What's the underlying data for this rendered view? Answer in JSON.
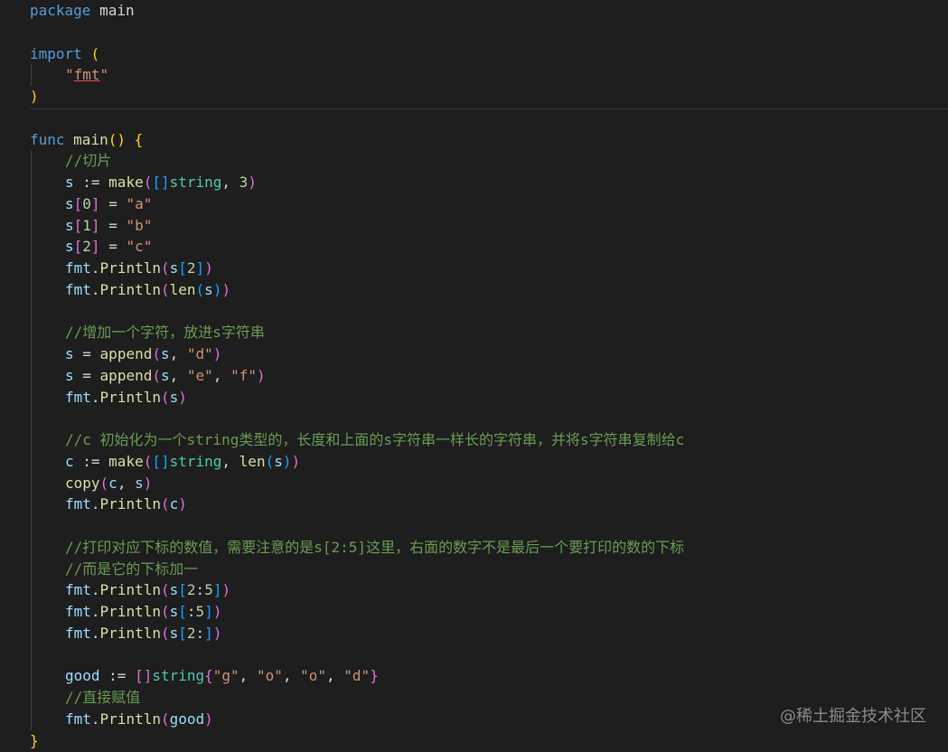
{
  "editor": {
    "lines": [
      {
        "indent": 0,
        "tokens": [
          [
            "package",
            "k"
          ],
          [
            " main",
            "d"
          ]
        ]
      },
      {
        "indent": 0,
        "tokens": []
      },
      {
        "indent": 0,
        "tokens": [
          [
            "import",
            "k"
          ],
          [
            " ",
            "d"
          ],
          [
            "(",
            "b1"
          ]
        ]
      },
      {
        "indent": 1,
        "tokens": [
          [
            "\"",
            "s"
          ],
          [
            "fmt",
            "s u"
          ],
          [
            "\"",
            "s"
          ]
        ]
      },
      {
        "indent": 0,
        "tokens": [
          [
            ")",
            "b1"
          ]
        ]
      },
      {
        "indent": 0,
        "tokens": []
      },
      {
        "indent": 0,
        "tokens": [
          [
            "func",
            "k"
          ],
          [
            " ",
            "d"
          ],
          [
            "main",
            "f"
          ],
          [
            "()",
            "b1"
          ],
          [
            " ",
            "d"
          ],
          [
            "{",
            "b1"
          ]
        ]
      },
      {
        "indent": 1,
        "tokens": [
          [
            "//切片",
            "c"
          ]
        ]
      },
      {
        "indent": 1,
        "tokens": [
          [
            "s",
            "v"
          ],
          [
            " := ",
            "d"
          ],
          [
            "make",
            "f"
          ],
          [
            "(",
            "b2"
          ],
          [
            "[]",
            "b3"
          ],
          [
            "string",
            "t"
          ],
          [
            ", ",
            "d"
          ],
          [
            "3",
            "n"
          ],
          [
            ")",
            "b2"
          ]
        ]
      },
      {
        "indent": 1,
        "tokens": [
          [
            "s",
            "v"
          ],
          [
            "[",
            "b2"
          ],
          [
            "0",
            "n"
          ],
          [
            "]",
            "b2"
          ],
          [
            " = ",
            "d"
          ],
          [
            "\"a\"",
            "s"
          ]
        ]
      },
      {
        "indent": 1,
        "tokens": [
          [
            "s",
            "v"
          ],
          [
            "[",
            "b2"
          ],
          [
            "1",
            "n"
          ],
          [
            "]",
            "b2"
          ],
          [
            " = ",
            "d"
          ],
          [
            "\"b\"",
            "s"
          ]
        ]
      },
      {
        "indent": 1,
        "tokens": [
          [
            "s",
            "v"
          ],
          [
            "[",
            "b2"
          ],
          [
            "2",
            "n"
          ],
          [
            "]",
            "b2"
          ],
          [
            " = ",
            "d"
          ],
          [
            "\"c\"",
            "s"
          ]
        ]
      },
      {
        "indent": 1,
        "tokens": [
          [
            "fmt",
            "v"
          ],
          [
            ".",
            "d"
          ],
          [
            "Println",
            "f"
          ],
          [
            "(",
            "b2"
          ],
          [
            "s",
            "v"
          ],
          [
            "[",
            "b3"
          ],
          [
            "2",
            "n"
          ],
          [
            "]",
            "b3"
          ],
          [
            ")",
            "b2"
          ]
        ]
      },
      {
        "indent": 1,
        "tokens": [
          [
            "fmt",
            "v"
          ],
          [
            ".",
            "d"
          ],
          [
            "Println",
            "f"
          ],
          [
            "(",
            "b2"
          ],
          [
            "len",
            "f"
          ],
          [
            "(",
            "b3"
          ],
          [
            "s",
            "v"
          ],
          [
            ")",
            "b3"
          ],
          [
            ")",
            "b2"
          ]
        ]
      },
      {
        "indent": 1,
        "tokens": []
      },
      {
        "indent": 1,
        "tokens": [
          [
            "//增加一个字符，放进s字符串",
            "c"
          ]
        ]
      },
      {
        "indent": 1,
        "tokens": [
          [
            "s",
            "v"
          ],
          [
            " = ",
            "d"
          ],
          [
            "append",
            "f"
          ],
          [
            "(",
            "b2"
          ],
          [
            "s",
            "v"
          ],
          [
            ", ",
            "d"
          ],
          [
            "\"d\"",
            "s"
          ],
          [
            ")",
            "b2"
          ]
        ]
      },
      {
        "indent": 1,
        "tokens": [
          [
            "s",
            "v"
          ],
          [
            " = ",
            "d"
          ],
          [
            "append",
            "f"
          ],
          [
            "(",
            "b2"
          ],
          [
            "s",
            "v"
          ],
          [
            ", ",
            "d"
          ],
          [
            "\"e\"",
            "s"
          ],
          [
            ", ",
            "d"
          ],
          [
            "\"f\"",
            "s"
          ],
          [
            ")",
            "b2"
          ]
        ]
      },
      {
        "indent": 1,
        "tokens": [
          [
            "fmt",
            "v"
          ],
          [
            ".",
            "d"
          ],
          [
            "Println",
            "f"
          ],
          [
            "(",
            "b2"
          ],
          [
            "s",
            "v"
          ],
          [
            ")",
            "b2"
          ]
        ]
      },
      {
        "indent": 1,
        "tokens": []
      },
      {
        "indent": 1,
        "tokens": [
          [
            "//c 初始化为一个string类型的，长度和上面的s字符串一样长的字符串，并将s字符串复制给c",
            "c"
          ]
        ]
      },
      {
        "indent": 1,
        "tokens": [
          [
            "c",
            "v"
          ],
          [
            " := ",
            "d"
          ],
          [
            "make",
            "f"
          ],
          [
            "(",
            "b2"
          ],
          [
            "[]",
            "b3"
          ],
          [
            "string",
            "t"
          ],
          [
            ", ",
            "d"
          ],
          [
            "len",
            "f"
          ],
          [
            "(",
            "b3"
          ],
          [
            "s",
            "v"
          ],
          [
            ")",
            "b3"
          ],
          [
            ")",
            "b2"
          ]
        ]
      },
      {
        "indent": 1,
        "tokens": [
          [
            "copy",
            "f"
          ],
          [
            "(",
            "b2"
          ],
          [
            "c",
            "v"
          ],
          [
            ", ",
            "d"
          ],
          [
            "s",
            "v"
          ],
          [
            ")",
            "b2"
          ]
        ]
      },
      {
        "indent": 1,
        "tokens": [
          [
            "fmt",
            "v"
          ],
          [
            ".",
            "d"
          ],
          [
            "Println",
            "f"
          ],
          [
            "(",
            "b2"
          ],
          [
            "c",
            "v"
          ],
          [
            ")",
            "b2"
          ]
        ]
      },
      {
        "indent": 1,
        "tokens": []
      },
      {
        "indent": 1,
        "tokens": [
          [
            "//打印对应下标的数值，需要注意的是s[2:5]这里，右面的数字不是最后一个要打印的数的下标",
            "c"
          ]
        ]
      },
      {
        "indent": 1,
        "tokens": [
          [
            "//而是它的下标加一",
            "c"
          ]
        ]
      },
      {
        "indent": 1,
        "tokens": [
          [
            "fmt",
            "v"
          ],
          [
            ".",
            "d"
          ],
          [
            "Println",
            "f"
          ],
          [
            "(",
            "b2"
          ],
          [
            "s",
            "v"
          ],
          [
            "[",
            "b3"
          ],
          [
            "2",
            "n"
          ],
          [
            ":",
            "d"
          ],
          [
            "5",
            "n"
          ],
          [
            "]",
            "b3"
          ],
          [
            ")",
            "b2"
          ]
        ]
      },
      {
        "indent": 1,
        "tokens": [
          [
            "fmt",
            "v"
          ],
          [
            ".",
            "d"
          ],
          [
            "Println",
            "f"
          ],
          [
            "(",
            "b2"
          ],
          [
            "s",
            "v"
          ],
          [
            "[",
            "b3"
          ],
          [
            ":",
            "d"
          ],
          [
            "5",
            "n"
          ],
          [
            "]",
            "b3"
          ],
          [
            ")",
            "b2"
          ]
        ]
      },
      {
        "indent": 1,
        "tokens": [
          [
            "fmt",
            "v"
          ],
          [
            ".",
            "d"
          ],
          [
            "Println",
            "f"
          ],
          [
            "(",
            "b2"
          ],
          [
            "s",
            "v"
          ],
          [
            "[",
            "b3"
          ],
          [
            "2",
            "n"
          ],
          [
            ":",
            "d"
          ],
          [
            "]",
            "b3"
          ],
          [
            ")",
            "b2"
          ]
        ]
      },
      {
        "indent": 1,
        "tokens": []
      },
      {
        "indent": 1,
        "tokens": [
          [
            "good",
            "v"
          ],
          [
            " := ",
            "d"
          ],
          [
            "[]",
            "b2"
          ],
          [
            "string",
            "t"
          ],
          [
            "{",
            "b2"
          ],
          [
            "\"g\"",
            "s"
          ],
          [
            ", ",
            "d"
          ],
          [
            "\"o\"",
            "s"
          ],
          [
            ", ",
            "d"
          ],
          [
            "\"o\"",
            "s"
          ],
          [
            ", ",
            "d"
          ],
          [
            "\"d\"",
            "s"
          ],
          [
            "}",
            "b2"
          ]
        ]
      },
      {
        "indent": 1,
        "tokens": [
          [
            "//直接赋值",
            "c"
          ]
        ]
      },
      {
        "indent": 1,
        "tokens": [
          [
            "fmt",
            "v"
          ],
          [
            ".",
            "d"
          ],
          [
            "Println",
            "f"
          ],
          [
            "(",
            "b2"
          ],
          [
            "good",
            "v"
          ],
          [
            ")",
            "b2"
          ]
        ]
      },
      {
        "indent": 0,
        "tokens": [
          [
            "}",
            "b1"
          ]
        ]
      }
    ]
  },
  "watermark": "@稀土掘金技术社区"
}
